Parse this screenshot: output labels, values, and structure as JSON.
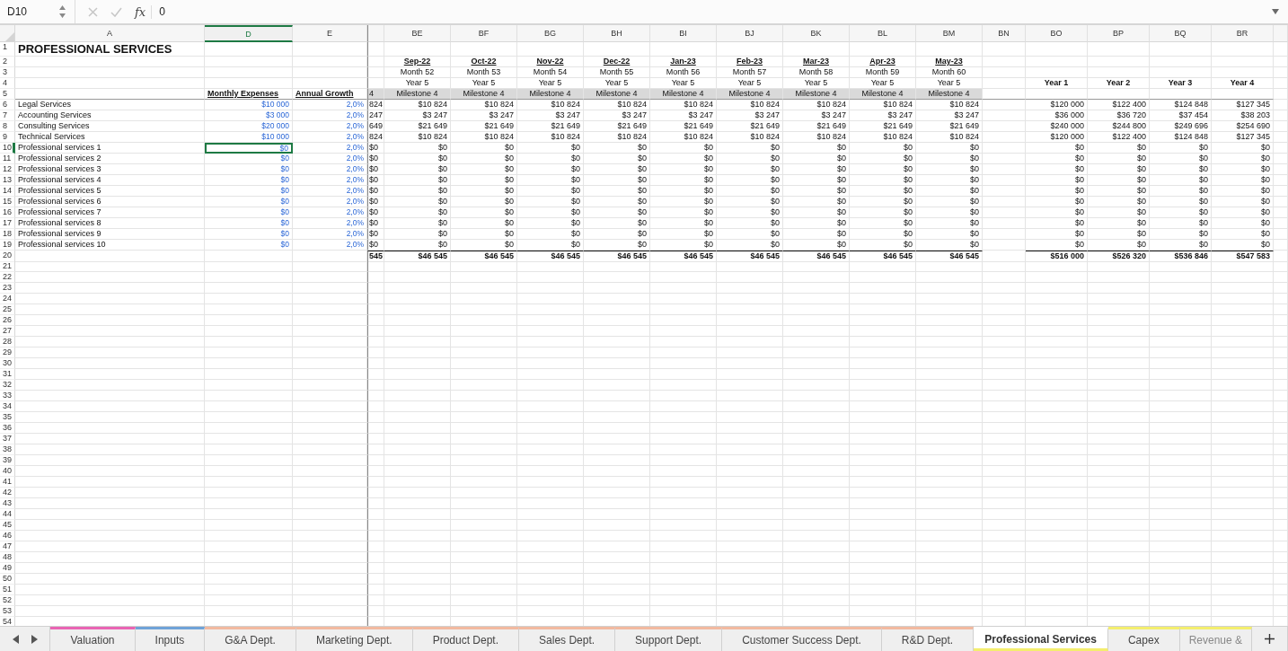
{
  "formula_bar": {
    "cell": "D10",
    "function_label": "fx",
    "value": "0"
  },
  "columns": [
    {
      "label": "A",
      "kind": "label",
      "selected": false
    },
    {
      "label": "D",
      "kind": "input",
      "selected": true
    },
    {
      "label": "E",
      "kind": "input",
      "selected": false
    },
    {
      "kind": "cut",
      "selected": false
    },
    {
      "label": "BE",
      "kind": "month",
      "selected": false
    },
    {
      "label": "BF",
      "kind": "month",
      "selected": false
    },
    {
      "label": "BG",
      "kind": "month",
      "selected": false
    },
    {
      "label": "BH",
      "kind": "month",
      "selected": false
    },
    {
      "label": "BI",
      "kind": "month",
      "selected": false
    },
    {
      "label": "BJ",
      "kind": "month",
      "selected": false
    },
    {
      "label": "BK",
      "kind": "month",
      "selected": false
    },
    {
      "label": "BL",
      "kind": "month",
      "selected": false
    },
    {
      "label": "BM",
      "kind": "month",
      "selected": false
    },
    {
      "label": "BN",
      "kind": "spacer",
      "selected": false
    },
    {
      "label": "BO",
      "kind": "year",
      "selected": false
    },
    {
      "label": "BP",
      "kind": "year",
      "selected": false
    },
    {
      "label": "BQ",
      "kind": "year",
      "selected": false
    },
    {
      "label": "BR",
      "kind": "year",
      "selected": false
    }
  ],
  "rows": [
    {
      "number": "1",
      "kind": "title",
      "selected": false,
      "cells": [
        "PROFESSIONAL SERVICES"
      ]
    },
    {
      "number": "2",
      "kind": "date",
      "selected": false,
      "cells": [
        null,
        null,
        null,
        null,
        "Sep-22",
        "Oct-22",
        "Nov-22",
        "Dec-22",
        "Jan-23",
        "Feb-23",
        "Mar-23",
        "Apr-23",
        "May-23"
      ]
    },
    {
      "number": "3",
      "kind": "plain",
      "selected": false,
      "cells": [
        null,
        null,
        null,
        null,
        "Month 52",
        "Month 53",
        "Month 54",
        "Month 55",
        "Month 56",
        "Month 57",
        "Month 58",
        "Month 59",
        "Month 60"
      ]
    },
    {
      "number": "4",
      "kind": "plain",
      "selected": false,
      "cells": [
        null,
        null,
        null,
        null,
        "Year 5",
        "Year 5",
        "Year 5",
        "Year 5",
        "Year 5",
        "Year 5",
        "Year 5",
        "Year 5",
        "Year 5",
        null,
        "Year 1",
        "Year 2",
        "Year 3",
        "Year 4"
      ]
    },
    {
      "number": "5",
      "kind": "header",
      "selected": false,
      "cells": [
        null,
        "Monthly Expenses",
        "Annual Growth",
        "4",
        "Milestone 4",
        "Milestone 4",
        "Milestone 4",
        "Milestone 4",
        "Milestone 4",
        "Milestone 4",
        "Milestone 4",
        "Milestone 4",
        "Milestone 4"
      ]
    },
    {
      "number": "6",
      "kind": "data",
      "selected": false,
      "cells": [
        "Legal Services",
        "$10 000",
        "2,0%",
        "824",
        "$10 824",
        "$10 824",
        "$10 824",
        "$10 824",
        "$10 824",
        "$10 824",
        "$10 824",
        "$10 824",
        "$10 824",
        null,
        "$120 000",
        "$122 400",
        "$124 848",
        "$127 345"
      ]
    },
    {
      "number": "7",
      "kind": "data",
      "selected": false,
      "cells": [
        "Accounting Services",
        "$3 000",
        "2,0%",
        "247",
        "$3 247",
        "$3 247",
        "$3 247",
        "$3 247",
        "$3 247",
        "$3 247",
        "$3 247",
        "$3 247",
        "$3 247",
        null,
        "$36 000",
        "$36 720",
        "$37 454",
        "$38 203"
      ]
    },
    {
      "number": "8",
      "kind": "data",
      "selected": false,
      "cells": [
        "Consulting Services",
        "$20 000",
        "2,0%",
        "649",
        "$21 649",
        "$21 649",
        "$21 649",
        "$21 649",
        "$21 649",
        "$21 649",
        "$21 649",
        "$21 649",
        "$21 649",
        null,
        "$240 000",
        "$244 800",
        "$249 696",
        "$254 690"
      ]
    },
    {
      "number": "9",
      "kind": "data",
      "selected": false,
      "cells": [
        "Technical Services",
        "$10 000",
        "2,0%",
        "824",
        "$10 824",
        "$10 824",
        "$10 824",
        "$10 824",
        "$10 824",
        "$10 824",
        "$10 824",
        "$10 824",
        "$10 824",
        null,
        "$120 000",
        "$122 400",
        "$124 848",
        "$127 345"
      ]
    },
    {
      "number": "10",
      "kind": "data",
      "selected": true,
      "cells": [
        "Professional services 1",
        "$0",
        "2,0%",
        "$0",
        "$0",
        "$0",
        "$0",
        "$0",
        "$0",
        "$0",
        "$0",
        "$0",
        "$0",
        null,
        "$0",
        "$0",
        "$0",
        "$0"
      ]
    },
    {
      "number": "11",
      "kind": "data",
      "selected": false,
      "cells": [
        "Professional services 2",
        "$0",
        "2,0%",
        "$0",
        "$0",
        "$0",
        "$0",
        "$0",
        "$0",
        "$0",
        "$0",
        "$0",
        "$0",
        null,
        "$0",
        "$0",
        "$0",
        "$0"
      ]
    },
    {
      "number": "12",
      "kind": "data",
      "selected": false,
      "cells": [
        "Professional services 3",
        "$0",
        "2,0%",
        "$0",
        "$0",
        "$0",
        "$0",
        "$0",
        "$0",
        "$0",
        "$0",
        "$0",
        "$0",
        null,
        "$0",
        "$0",
        "$0",
        "$0"
      ]
    },
    {
      "number": "13",
      "kind": "data",
      "selected": false,
      "cells": [
        "Professional services 4",
        "$0",
        "2,0%",
        "$0",
        "$0",
        "$0",
        "$0",
        "$0",
        "$0",
        "$0",
        "$0",
        "$0",
        "$0",
        null,
        "$0",
        "$0",
        "$0",
        "$0"
      ]
    },
    {
      "number": "14",
      "kind": "data",
      "selected": false,
      "cells": [
        "Professional services 5",
        "$0",
        "2,0%",
        "$0",
        "$0",
        "$0",
        "$0",
        "$0",
        "$0",
        "$0",
        "$0",
        "$0",
        "$0",
        null,
        "$0",
        "$0",
        "$0",
        "$0"
      ]
    },
    {
      "number": "15",
      "kind": "data",
      "selected": false,
      "cells": [
        "Professional services 6",
        "$0",
        "2,0%",
        "$0",
        "$0",
        "$0",
        "$0",
        "$0",
        "$0",
        "$0",
        "$0",
        "$0",
        "$0",
        null,
        "$0",
        "$0",
        "$0",
        "$0"
      ]
    },
    {
      "number": "16",
      "kind": "data",
      "selected": false,
      "cells": [
        "Professional services 7",
        "$0",
        "2,0%",
        "$0",
        "$0",
        "$0",
        "$0",
        "$0",
        "$0",
        "$0",
        "$0",
        "$0",
        "$0",
        null,
        "$0",
        "$0",
        "$0",
        "$0"
      ]
    },
    {
      "number": "17",
      "kind": "data",
      "selected": false,
      "cells": [
        "Professional services 8",
        "$0",
        "2,0%",
        "$0",
        "$0",
        "$0",
        "$0",
        "$0",
        "$0",
        "$0",
        "$0",
        "$0",
        "$0",
        null,
        "$0",
        "$0",
        "$0",
        "$0"
      ]
    },
    {
      "number": "18",
      "kind": "data",
      "selected": false,
      "cells": [
        "Professional services 9",
        "$0",
        "2,0%",
        "$0",
        "$0",
        "$0",
        "$0",
        "$0",
        "$0",
        "$0",
        "$0",
        "$0",
        "$0",
        null,
        "$0",
        "$0",
        "$0",
        "$0"
      ]
    },
    {
      "number": "19",
      "kind": "data",
      "selected": false,
      "cells": [
        "Professional services 10",
        "$0",
        "2,0%",
        "$0",
        "$0",
        "$0",
        "$0",
        "$0",
        "$0",
        "$0",
        "$0",
        "$0",
        "$0",
        null,
        "$0",
        "$0",
        "$0",
        "$0"
      ]
    },
    {
      "number": "20",
      "kind": "total",
      "selected": false,
      "cells": [
        null,
        null,
        null,
        "545",
        "$46 545",
        "$46 545",
        "$46 545",
        "$46 545",
        "$46 545",
        "$46 545",
        "$46 545",
        "$46 545",
        "$46 545",
        null,
        "$516 000",
        "$526 320",
        "$536 846",
        "$547 583"
      ]
    },
    {
      "number": "21",
      "kind": "data",
      "selected": false
    },
    {
      "number": "22",
      "kind": "data",
      "selected": false
    },
    {
      "number": "23",
      "kind": "data",
      "selected": false
    },
    {
      "number": "24",
      "kind": "data",
      "selected": false
    },
    {
      "number": "25",
      "kind": "data",
      "selected": false
    },
    {
      "number": "26",
      "kind": "data",
      "selected": false
    },
    {
      "number": "27",
      "kind": "data",
      "selected": false
    },
    {
      "number": "28",
      "kind": "data",
      "selected": false
    },
    {
      "number": "29",
      "kind": "data",
      "selected": false
    },
    {
      "number": "30",
      "kind": "data",
      "selected": false
    },
    {
      "number": "31",
      "kind": "data",
      "selected": false
    },
    {
      "number": "32",
      "kind": "data",
      "selected": false
    },
    {
      "number": "33",
      "kind": "data",
      "selected": false
    },
    {
      "number": "34",
      "kind": "data",
      "selected": false
    },
    {
      "number": "35",
      "kind": "data",
      "selected": false
    },
    {
      "number": "36",
      "kind": "data",
      "selected": false
    },
    {
      "number": "37",
      "kind": "data",
      "selected": false
    },
    {
      "number": "38",
      "kind": "data",
      "selected": false
    },
    {
      "number": "39",
      "kind": "data",
      "selected": false
    },
    {
      "number": "40",
      "kind": "data",
      "selected": false
    },
    {
      "number": "41",
      "kind": "data",
      "selected": false
    },
    {
      "number": "42",
      "kind": "data",
      "selected": false
    },
    {
      "number": "43",
      "kind": "data",
      "selected": false
    },
    {
      "number": "44",
      "kind": "data",
      "selected": false
    },
    {
      "number": "45",
      "kind": "data",
      "selected": false
    },
    {
      "number": "46",
      "kind": "data",
      "selected": false
    },
    {
      "number": "47",
      "kind": "data",
      "selected": false
    },
    {
      "number": "48",
      "kind": "data",
      "selected": false
    },
    {
      "number": "49",
      "kind": "data",
      "selected": false
    },
    {
      "number": "50",
      "kind": "data",
      "selected": false
    },
    {
      "number": "51",
      "kind": "data",
      "selected": false
    },
    {
      "number": "52",
      "kind": "data",
      "selected": false
    },
    {
      "number": "53",
      "kind": "data",
      "selected": false
    },
    {
      "number": "54",
      "kind": "data",
      "selected": false
    }
  ],
  "sheet_tabs": [
    {
      "label": "Valuation",
      "color": "#e964b4",
      "selected": false
    },
    {
      "label": "Inputs",
      "color": "#6fa3d8",
      "selected": false
    },
    {
      "label": "G&A Dept.",
      "color": "#f2b9a0",
      "selected": false
    },
    {
      "label": "Marketing Dept.",
      "color": "#f2b9a0",
      "selected": false
    },
    {
      "label": "Product Dept.",
      "color": "#f2b9a0",
      "selected": false
    },
    {
      "label": "Sales Dept.",
      "color": "#f2b9a0",
      "selected": false
    },
    {
      "label": "Support Dept.",
      "color": "#f2b9a0",
      "selected": false
    },
    {
      "label": "Customer Success Dept.",
      "color": "#f2b9a0",
      "selected": false
    },
    {
      "label": "R&D Dept.",
      "color": "#f2b9a0",
      "selected": false
    },
    {
      "label": "Professional Services",
      "color": "#f4ee6e",
      "selected": true
    },
    {
      "label": "Capex",
      "color": "#f4ee6e",
      "selected": false
    },
    {
      "label": "Revenue &",
      "color": "#f4ee6e",
      "selected": false
    }
  ]
}
